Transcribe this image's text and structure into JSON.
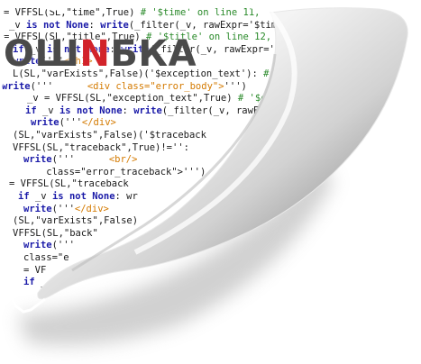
{
  "logo": {
    "part1": "ОШ",
    "accent": "N",
    "part2": "БКА"
  },
  "code_lines": [
    "= VFFSL(SL,\"time\",True) # '$time' on line 11,",
    "_v is not None: write(_filter(_v, rawExpr='$time')) #",
    "= VFFSL(SL,\"title\",True) # '$title' on line 12, c",
    "if _v is not None: write(_filter(_v, rawExpr='$t",
    "write('''</h1>",
    "L(SL,\"varExists\",False)('$exception_text'): #",
    "write('''      <div class=\"error_body\">''')",
    "_v = VFFSL(SL,\"exception_text\",True) # '$ex",
    "if _v is not None: write(_filter(_v, rawE",
    "write('''</div>",
    "(SL,\"varExists\",False)('$traceback",
    "VFFSL(SL,\"traceback\",True)!='':",
    "write('''      <br/>",
    "    class=\"error_traceback\">''')",
    "= VFFSL(SL,\"traceback",
    "if _v is not None: wr",
    "write('''</div>",
    "(SL,\"varExists\",False)",
    "VFFSL(SL,\"back\"",
    "write('''",
    "class=\"e",
    "= VF",
    "if _"
  ],
  "colors": {
    "keyword": "#1a1aa8",
    "string": "#2a8a2a",
    "tag": "#d47a00",
    "logo_gray": "#4a4a4a",
    "logo_red": "#d2232a"
  }
}
